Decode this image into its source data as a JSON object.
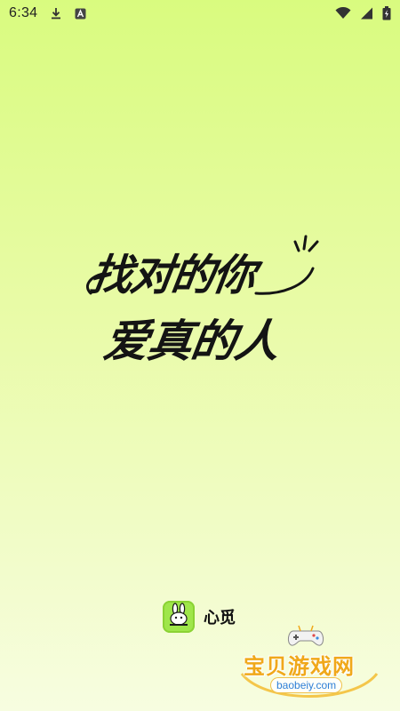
{
  "status_bar": {
    "time": "6:34",
    "icons": [
      "download-icon",
      "a-notification-icon",
      "wifi-icon",
      "signal-icon",
      "battery-icon"
    ]
  },
  "slogan": {
    "line1": "找对的你",
    "line2": "爱真的人"
  },
  "app": {
    "name": "心觅",
    "logo_icon": "rabbit-icon",
    "logo_color": "#9fe64a"
  },
  "watermark": {
    "title": "宝贝游戏网",
    "url": "baobeiy.com",
    "icon": "gamepad-icon",
    "title_color": "#f0a81a",
    "url_color": "#2f7fd6"
  },
  "colors": {
    "background_top": "#d9fb7f",
    "background_bottom": "#f7fde0",
    "text": "#141414"
  }
}
